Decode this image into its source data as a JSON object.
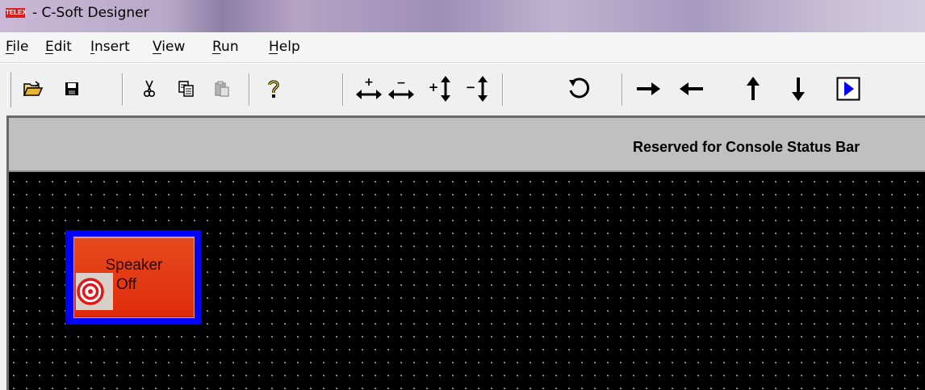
{
  "window": {
    "app_icon_text": "TELEX",
    "title": "- C-Soft Designer"
  },
  "menu": [
    {
      "label": "File"
    },
    {
      "label": "Edit"
    },
    {
      "label": "Insert"
    },
    {
      "label": "View"
    },
    {
      "label": "Run"
    },
    {
      "label": "Help"
    }
  ],
  "toolbar": {
    "buttons": [
      {
        "icon": "open-folder-icon"
      },
      {
        "icon": "save-icon"
      },
      {
        "icon": "cut-icon"
      },
      {
        "icon": "copy-icon"
      },
      {
        "icon": "paste-icon"
      },
      {
        "icon": "help-icon"
      },
      {
        "icon": "increase-width-icon",
        "glyph": "+"
      },
      {
        "icon": "decrease-width-icon",
        "glyph": "−"
      },
      {
        "icon": "increase-height-icon",
        "glyph": "+"
      },
      {
        "icon": "decrease-height-icon",
        "glyph": "−"
      },
      {
        "icon": "undo-icon"
      },
      {
        "icon": "move-right-icon"
      },
      {
        "icon": "move-left-icon"
      },
      {
        "icon": "move-up-icon"
      },
      {
        "icon": "move-down-icon"
      },
      {
        "icon": "run-icon"
      }
    ],
    "disabled_color": "#a0a0a0",
    "run_accent": "#0000ff"
  },
  "design_area": {
    "banner_text": "Reserved for Console Status Bar",
    "background": "#000000",
    "grid_dot_color": "#9a9a9a"
  },
  "speaker_button": {
    "line1": "Speaker",
    "line2": "Off",
    "icon": "target-icon",
    "frame_color": "#0000ff",
    "fill_color": "#e4380f"
  }
}
